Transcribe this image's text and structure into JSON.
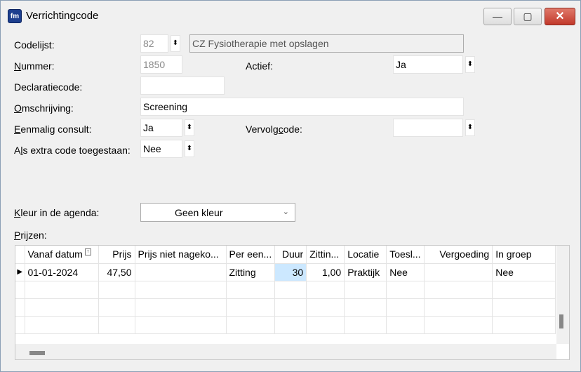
{
  "window": {
    "title": "Verrichtingcode",
    "app_icon_text": "fm",
    "minimize_glyph": "—",
    "maximize_glyph": "▢",
    "close_glyph": "✕"
  },
  "form": {
    "codelijst": {
      "label": "Codelijst:",
      "number": "82",
      "name": "CZ Fysiotherapie met opslagen"
    },
    "nummer": {
      "label": "Nummer:",
      "value": "1850"
    },
    "actief": {
      "label": "Actief:",
      "value": "Ja"
    },
    "declaratiecode": {
      "label": "Declaratiecode:",
      "value": ""
    },
    "omschrijving": {
      "label": "Omschrijving:",
      "value": "Screening"
    },
    "eenmalig_consult": {
      "label": "Eenmalig consult:",
      "value": "Ja"
    },
    "vervolgcode": {
      "label": "Vervolgcode:",
      "value": ""
    },
    "extra_code": {
      "label": "Als extra code toegestaan:",
      "value": "Nee"
    },
    "kleur": {
      "label": "Kleur in de agenda:",
      "value": "Geen kleur"
    },
    "prijzen_label": "Prijzen:",
    "spin_glyph": "⬍"
  },
  "grid": {
    "columns": [
      "Vanaf datum",
      "Prijs",
      "Prijs niet nageko...",
      "Per een...",
      "Duur",
      "Zittin...",
      "Locatie",
      "Toesl...",
      "Vergoeding",
      "In groep"
    ],
    "rows": [
      {
        "indicator": "▶",
        "cells": [
          "01-01-2024",
          "47,50",
          "",
          "Zitting",
          "30",
          "1,00",
          "Praktijk",
          "Nee",
          "",
          "Nee"
        ]
      }
    ]
  }
}
